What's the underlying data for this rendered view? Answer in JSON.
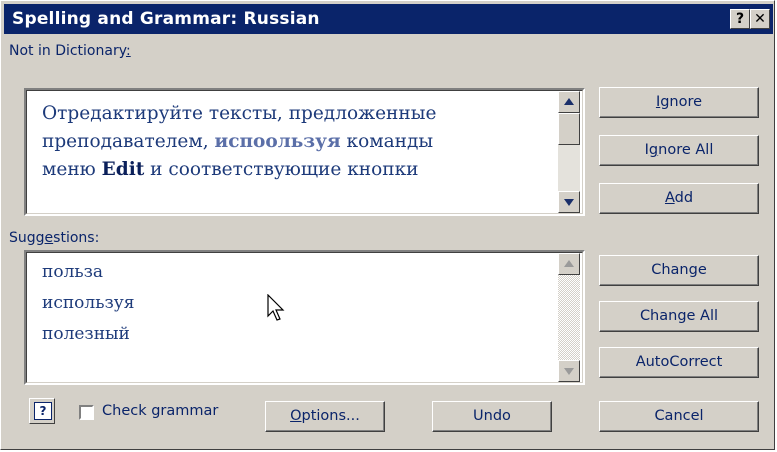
{
  "window": {
    "title": "Spelling and Grammar: Russian",
    "help_button": "?",
    "close_button": "✕"
  },
  "not_in_dictionary": {
    "label": "Not in Dictionary",
    "label_suffix": ":",
    "line1": "Отредактируйте тексты, предложенные",
    "line2_before": "преподавателем, ",
    "line2_error": "испоользуя",
    "line2_after": " команды",
    "line3_before": "меню ",
    "line3_bold": "Edit",
    "line3_after": " и соответствующие кнопки"
  },
  "suggestions": {
    "label_pre": "Sugg",
    "label_u": "e",
    "label_post": "stions:",
    "items": [
      "польза",
      "используя",
      "полезный"
    ]
  },
  "buttons": {
    "ignore_u": "I",
    "ignore_rest": "gnore",
    "ignore_all_pre": "I",
    "ignore_all_u": "g",
    "ignore_all_post": "nore All",
    "add_u": "A",
    "add_rest": "dd",
    "change": "Change",
    "change_all": "Change All",
    "autocorrect": "AutoCorrect",
    "cancel": "Cancel",
    "options_u": "O",
    "options_rest": "ptions...",
    "undo": "Undo"
  },
  "check_grammar": {
    "label": "Check grammar",
    "checked": false
  },
  "icons": {
    "help": "help-icon",
    "cursor": "mouse-pointer-icon"
  },
  "colors": {
    "titlebar": "#0a246a",
    "face": "#d4d0c8",
    "text": "#0a246a"
  }
}
